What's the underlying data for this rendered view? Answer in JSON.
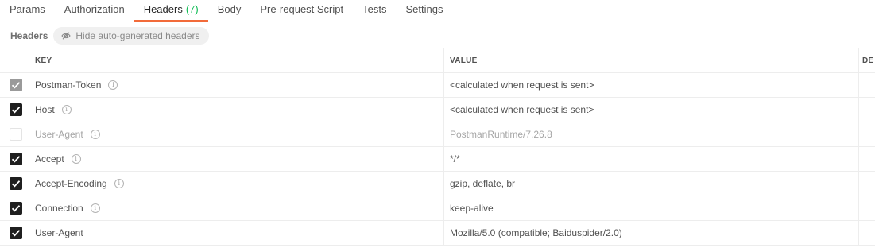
{
  "tabs": [
    {
      "label": "Params",
      "active": false
    },
    {
      "label": "Authorization",
      "active": false
    },
    {
      "label": "Headers",
      "count": "(7)",
      "active": true
    },
    {
      "label": "Body",
      "active": false
    },
    {
      "label": "Pre-request Script",
      "active": false
    },
    {
      "label": "Tests",
      "active": false
    },
    {
      "label": "Settings",
      "active": false
    }
  ],
  "subheader": {
    "title": "Headers",
    "toggle_label": "Hide auto-generated headers"
  },
  "table": {
    "columns": {
      "key": "KEY",
      "value": "VALUE",
      "description": "DE"
    },
    "rows": [
      {
        "key": "Postman-Token",
        "value": "<calculated when request is sent>",
        "checked": "locked",
        "info": "i"
      },
      {
        "key": "Host",
        "value": "<calculated when request is sent>",
        "checked": "on",
        "info": "i"
      },
      {
        "key": "User-Agent",
        "value": "PostmanRuntime/7.26.8",
        "checked": "off",
        "info": "i"
      },
      {
        "key": "Accept",
        "value": "*/*",
        "checked": "on",
        "info": "i"
      },
      {
        "key": "Accept-Encoding",
        "value": "gzip, deflate, br",
        "checked": "on",
        "info": "i"
      },
      {
        "key": "Connection",
        "value": "keep-alive",
        "checked": "on",
        "info": "i"
      },
      {
        "key": "User-Agent",
        "value": "Mozilla/5.0 (compatible; Baiduspider/2.0)",
        "checked": "on",
        "info": ""
      }
    ]
  },
  "colors": {
    "accent_underline": "#f26b3a",
    "count_green": "#0cbb52",
    "checkbox_on": "#1f1f1f",
    "checkbox_locked": "#9a9a9a"
  },
  "icons": {
    "toggle": "eye-off-icon",
    "checkbox": "check-icon",
    "info": "info-icon"
  }
}
